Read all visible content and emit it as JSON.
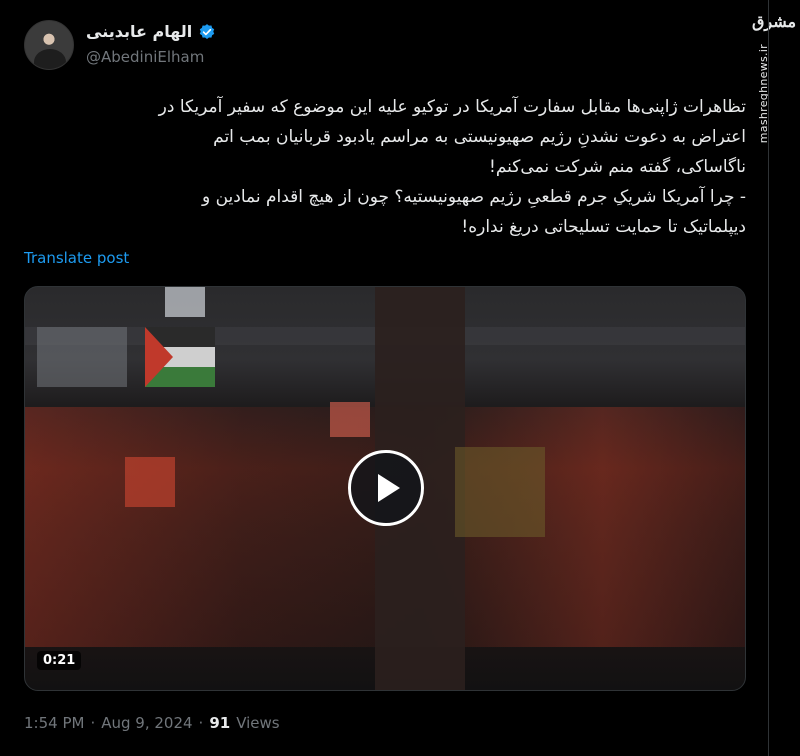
{
  "author": {
    "name": "الهام عابدینی",
    "handle": "@AbediniElham",
    "verified_color": "#1d9bf0"
  },
  "side": {
    "logo_text": "مشرق",
    "url": "mashreghnews.ir"
  },
  "tweet": {
    "lines": [
      "تظاهرات ژاپنی‌ها مقابل سفارت آمریکا در توکیو علیه این موضوع که سفیر آمریکا در",
      "اعتراض به دعوت نشدنِ رژیم صهیونیستی به مراسم یادبود قربانیان بمب اتم",
      "ناگاساکی، گفته منم شرکت نمی‌کنم!",
      "- چرا آمریکا شریکِ جرم قطعیِ رژیم صهیونیستیه؟ چون از هیچ اقدام نمادین و",
      "دیپلماتیک تا حمایت تسلیحاتی دریغ نداره!"
    ],
    "translate_label": "Translate post"
  },
  "media": {
    "duration": "0:21",
    "play_icon": "play-icon"
  },
  "meta": {
    "time": "1:54 PM",
    "separator": "·",
    "date": "Aug 9, 2024",
    "views_count": "91",
    "views_label": "Views"
  },
  "colors": {
    "background": "#000000",
    "text": "#e7e9ea",
    "muted": "#71767b",
    "accent": "#1d9bf0"
  }
}
